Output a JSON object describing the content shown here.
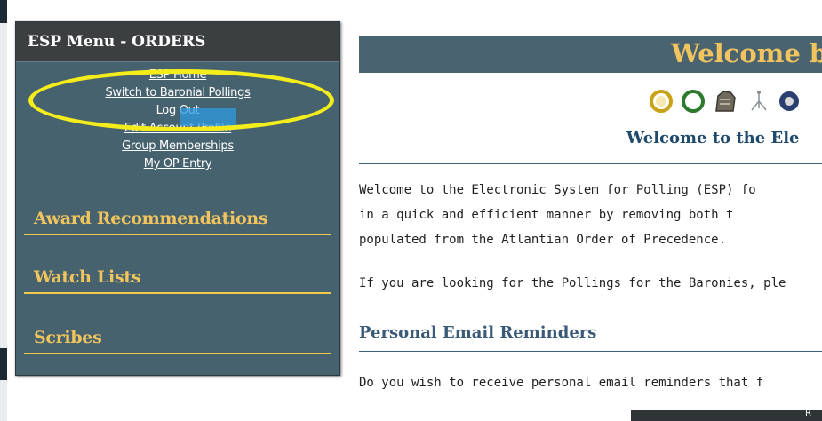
{
  "menu": {
    "title": "ESP Menu - ORDERS",
    "links": [
      "ESP Home",
      "Switch to Baronial Pollings",
      "Log Out",
      "Edit Account Profile",
      "Group Memberships",
      "My OP Entry"
    ],
    "sections": [
      "Award Recommendations",
      "Watch Lists",
      "Scribes"
    ]
  },
  "main": {
    "banner": "Welcome b",
    "subtitle": "Welcome to the Ele",
    "paragraph_lines": [
      "Welcome to the Electronic System for Polling (ESP) fo",
      "in a quick and efficient manner by removing both t",
      "populated from the Atlantian Order of Precedence.",
      "If you are looking for the Pollings for the Baronies, ple"
    ],
    "heading": "Personal Email Reminders",
    "reminder_line": "Do you wish to receive personal email reminders that f",
    "button_label": "R"
  },
  "colors": {
    "menu_bg": "#47626f",
    "accent_gold": "#f1c45d",
    "highlight_yellow": "#f4ed1b",
    "heading_blue": "#1f4a6b"
  },
  "icons": [
    "laurel-wreath-icon",
    "green-wreath-icon",
    "beast-icon",
    "tree-icon",
    "badge-icon"
  ]
}
